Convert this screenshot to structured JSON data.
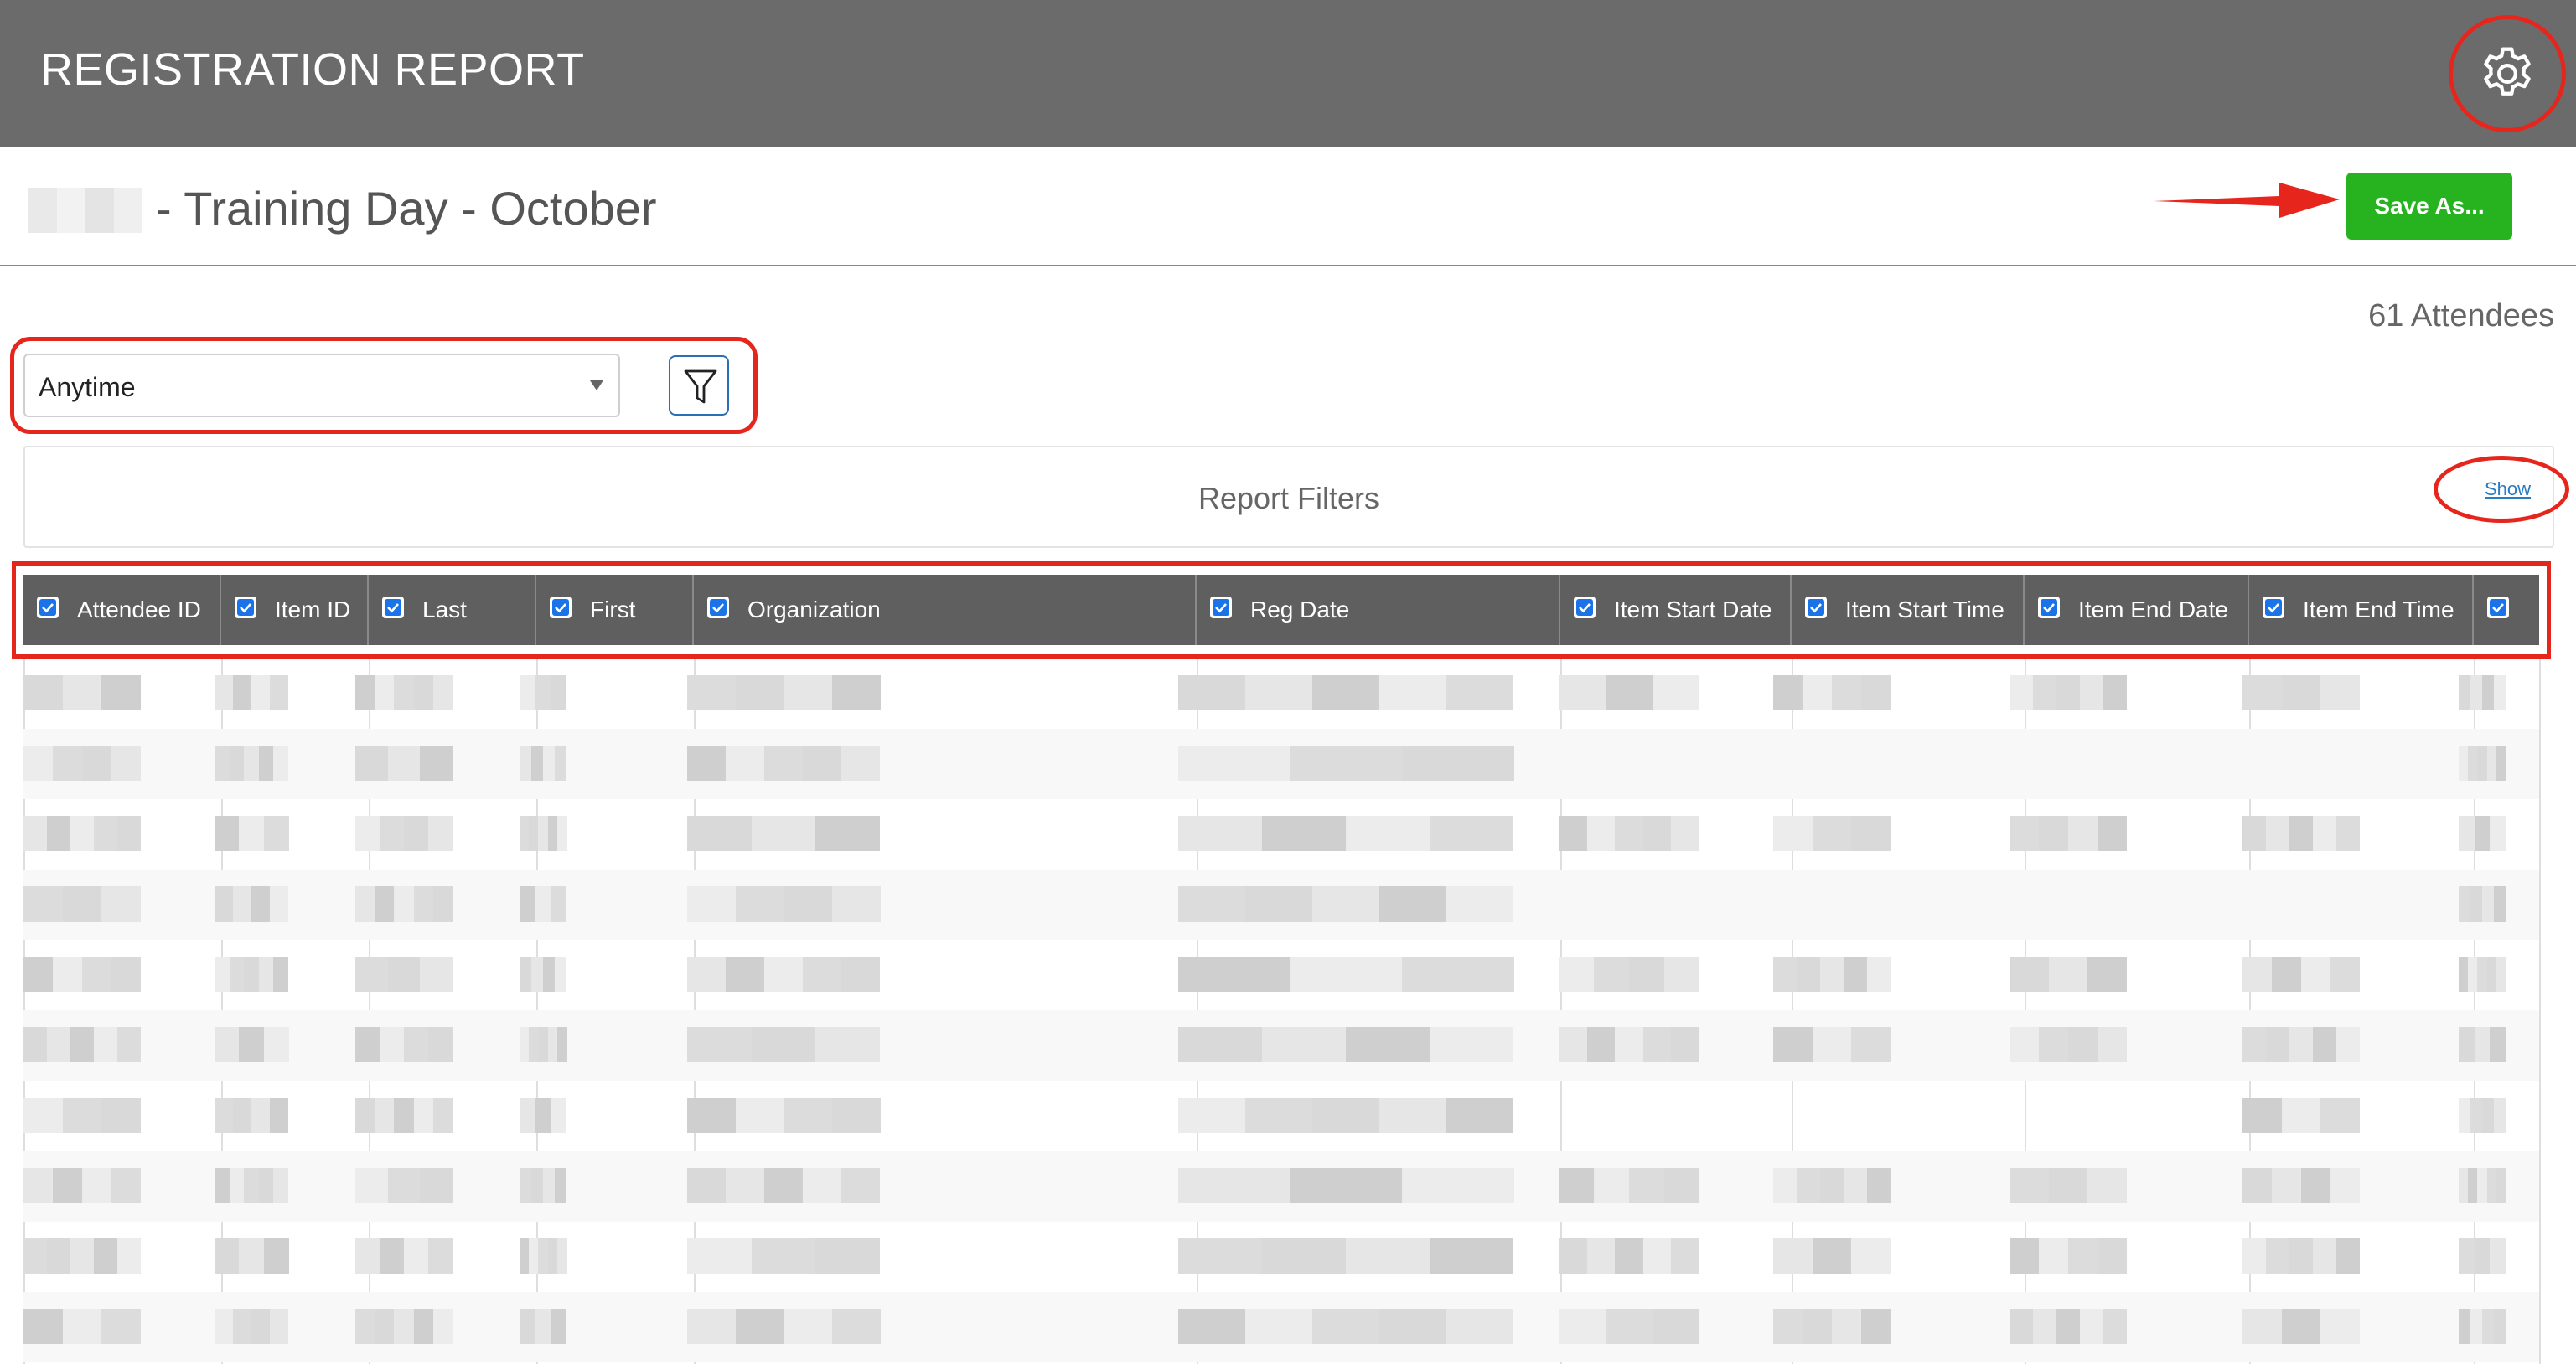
{
  "header": {
    "title": "REGISTRATION REPORT",
    "settings_icon": "gear-icon"
  },
  "titlebar": {
    "event_title": "- Training Day - October",
    "save_label": "Save As..."
  },
  "summary": {
    "attendees": "61 Attendees"
  },
  "date_filter": {
    "selected": "Anytime",
    "filter_icon": "funnel-icon"
  },
  "report_filters": {
    "title": "Report Filters",
    "toggle_label": "Show"
  },
  "table": {
    "columns": [
      {
        "label": "Attendee ID",
        "checked": true
      },
      {
        "label": "Item ID",
        "checked": true
      },
      {
        "label": "Last",
        "checked": true
      },
      {
        "label": "First",
        "checked": true
      },
      {
        "label": "Organization",
        "checked": true
      },
      {
        "label": "Reg Date",
        "checked": true
      },
      {
        "label": "Item Start Date",
        "checked": true
      },
      {
        "label": "Item Start Time",
        "checked": true
      },
      {
        "label": "Item End Date",
        "checked": true
      },
      {
        "label": "Item End Time",
        "checked": true
      },
      {
        "label": "",
        "checked": true
      }
    ]
  },
  "colors": {
    "header_bg": "#6b6b6b",
    "save_button": "#26b31f",
    "annotation": "#e6261c",
    "link": "#2b7bc1"
  }
}
